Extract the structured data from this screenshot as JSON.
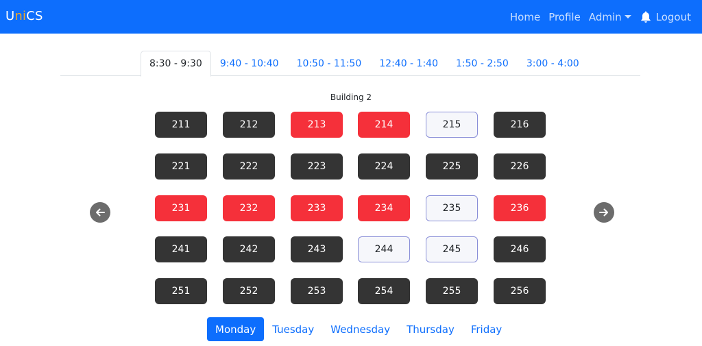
{
  "brand": {
    "prefix": "U",
    "highlight": "ni",
    "suffix": "CS"
  },
  "nav": {
    "home": "Home",
    "profile": "Profile",
    "admin": "Admin",
    "logout": "Logout"
  },
  "time_slots": [
    "8:30 - 9:30",
    "9:40 - 10:40",
    "10:50 - 11:50",
    "12:40 - 1:40",
    "1:50 - 2:50",
    "3:00 - 4:00"
  ],
  "active_slot": 0,
  "building": "Building 2",
  "rooms": [
    [
      {
        "n": "211",
        "s": "occupied"
      },
      {
        "n": "212",
        "s": "occupied"
      },
      {
        "n": "213",
        "s": "reserved"
      },
      {
        "n": "214",
        "s": "reserved"
      },
      {
        "n": "215",
        "s": "available"
      },
      {
        "n": "216",
        "s": "occupied"
      }
    ],
    [
      {
        "n": "221",
        "s": "occupied"
      },
      {
        "n": "222",
        "s": "occupied"
      },
      {
        "n": "223",
        "s": "occupied"
      },
      {
        "n": "224",
        "s": "occupied"
      },
      {
        "n": "225",
        "s": "occupied"
      },
      {
        "n": "226",
        "s": "occupied"
      }
    ],
    [
      {
        "n": "231",
        "s": "reserved"
      },
      {
        "n": "232",
        "s": "reserved"
      },
      {
        "n": "233",
        "s": "reserved"
      },
      {
        "n": "234",
        "s": "reserved"
      },
      {
        "n": "235",
        "s": "available"
      },
      {
        "n": "236",
        "s": "reserved"
      }
    ],
    [
      {
        "n": "241",
        "s": "occupied"
      },
      {
        "n": "242",
        "s": "occupied"
      },
      {
        "n": "243",
        "s": "occupied"
      },
      {
        "n": "244",
        "s": "available"
      },
      {
        "n": "245",
        "s": "available"
      },
      {
        "n": "246",
        "s": "occupied"
      }
    ],
    [
      {
        "n": "251",
        "s": "occupied"
      },
      {
        "n": "252",
        "s": "occupied"
      },
      {
        "n": "253",
        "s": "occupied"
      },
      {
        "n": "254",
        "s": "occupied"
      },
      {
        "n": "255",
        "s": "occupied"
      },
      {
        "n": "256",
        "s": "occupied"
      }
    ]
  ],
  "days": [
    "Monday",
    "Tuesday",
    "Wednesday",
    "Thursday",
    "Friday"
  ],
  "active_day": 0,
  "icons": {
    "bell": "bell-icon",
    "prev": "arrow-left-icon",
    "next": "arrow-right-icon"
  },
  "colors": {
    "primary": "#0d6efd",
    "occupied": "#343434",
    "reserved": "#f5303a",
    "available_border": "#8a8fd8"
  }
}
